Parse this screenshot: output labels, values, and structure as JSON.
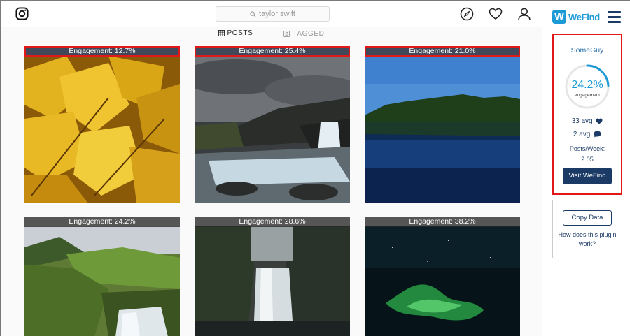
{
  "search": {
    "placeholder": "taylor swift"
  },
  "tabs": [
    {
      "label": "POSTS",
      "active": true
    },
    {
      "label": "TAGGED",
      "active": false
    }
  ],
  "posts": [
    {
      "engagement": "Engagement: 12.7%",
      "subject": "yellow maple leaves",
      "highlighted": true
    },
    {
      "engagement": "Engagement: 25.4%",
      "subject": "waterfall under stormy sky",
      "highlighted": true
    },
    {
      "engagement": "Engagement: 21.0%",
      "subject": "lake with forested island",
      "highlighted": true
    },
    {
      "engagement": "Engagement: 24.2%",
      "subject": "green hills and waterfall",
      "highlighted": false
    },
    {
      "engagement": "Engagement: 28.6%",
      "subject": "tall waterfall in canyon",
      "highlighted": false
    },
    {
      "engagement": "Engagement: 38.2%",
      "subject": "northern lights night sky",
      "highlighted": false
    }
  ],
  "wefind": {
    "brand": "WeFind",
    "username": "SomeGuy",
    "engagement_pct": "24.2%",
    "engagement_fraction": 0.242,
    "engagement_label": "engagement",
    "avg_likes": "33 avg",
    "avg_comments": "2 avg",
    "posts_per_week_label": "Posts/Week:",
    "posts_per_week_value": "2.05",
    "visit_label": "Visit WeFind",
    "copy_label": "Copy Data",
    "howto_label": "How does this plugin work?"
  },
  "colors": {
    "accent": "#1b9ad6",
    "navy": "#1b3a66",
    "highlight": "#e01818"
  },
  "icons": [
    "instagram-icon",
    "search-icon",
    "compass-icon",
    "heart-icon",
    "user-icon",
    "grid-icon",
    "tag-icon",
    "hamburger-icon"
  ]
}
